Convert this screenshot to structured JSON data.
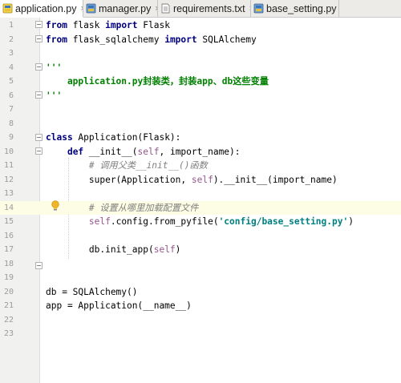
{
  "tabs": [
    {
      "label": "application.py",
      "active": true,
      "icon": "python-file-icon"
    },
    {
      "label": "manager.py",
      "active": false,
      "icon": "python-file-icon"
    },
    {
      "label": "requirements.txt",
      "active": false,
      "icon": "text-file-icon"
    },
    {
      "label": "base_setting.py",
      "active": false,
      "icon": "python-file-icon"
    }
  ],
  "tab_close": "×",
  "colors": {
    "keyword": "#000080",
    "string": "#008080",
    "docstring": "#008000",
    "self": "#94558d",
    "comment": "#808080",
    "highlight_line": "#fdfde5"
  },
  "lines": [
    {
      "n": "1",
      "tokens": [
        {
          "t": "kw",
          "v": "from"
        },
        {
          "t": "p",
          "v": " flask "
        },
        {
          "t": "kw",
          "v": "import"
        },
        {
          "t": "p",
          "v": " Flask"
        }
      ]
    },
    {
      "n": "2",
      "tokens": [
        {
          "t": "kw",
          "v": "from"
        },
        {
          "t": "p",
          "v": " flask_sqlalchemy "
        },
        {
          "t": "kw",
          "v": "import"
        },
        {
          "t": "p",
          "v": " SQLAlchemy"
        }
      ]
    },
    {
      "n": "3",
      "tokens": []
    },
    {
      "n": "4",
      "tokens": [
        {
          "t": "gstr",
          "v": "'''"
        }
      ]
    },
    {
      "n": "5",
      "tokens": [
        {
          "t": "gstr",
          "v": "    application.py封装类，封装app、db这些变量"
        }
      ]
    },
    {
      "n": "6",
      "tokens": [
        {
          "t": "gstr",
          "v": "'''"
        }
      ]
    },
    {
      "n": "7",
      "tokens": []
    },
    {
      "n": "8",
      "tokens": []
    },
    {
      "n": "9",
      "tokens": [
        {
          "t": "kw",
          "v": "class"
        },
        {
          "t": "p",
          "v": " Application(Flask):"
        }
      ]
    },
    {
      "n": "10",
      "tokens": [
        {
          "t": "p",
          "v": "    "
        },
        {
          "t": "kw",
          "v": "def"
        },
        {
          "t": "p",
          "v": " __init__("
        },
        {
          "t": "slf",
          "v": "self"
        },
        {
          "t": "p",
          "v": ", import_name):"
        }
      ]
    },
    {
      "n": "11",
      "tokens": [
        {
          "t": "cmt",
          "v": "        # 调用父类__init__()函数"
        }
      ]
    },
    {
      "n": "12",
      "tokens": [
        {
          "t": "p",
          "v": "        super(Application, "
        },
        {
          "t": "slf",
          "v": "self"
        },
        {
          "t": "p",
          "v": ").__init__(import_name)"
        }
      ]
    },
    {
      "n": "13",
      "tokens": []
    },
    {
      "n": "14",
      "tokens": [
        {
          "t": "cmt",
          "v": "        # 设置从哪里加载配置文件"
        }
      ],
      "highlight": true
    },
    {
      "n": "15",
      "tokens": [
        {
          "t": "p",
          "v": "        "
        },
        {
          "t": "slf",
          "v": "self"
        },
        {
          "t": "p",
          "v": ".config.from_pyfile("
        },
        {
          "t": "str",
          "v": "'config/base_setting.py'"
        },
        {
          "t": "p",
          "v": ")"
        }
      ]
    },
    {
      "n": "16",
      "tokens": []
    },
    {
      "n": "17",
      "tokens": [
        {
          "t": "p",
          "v": "        db.init_app("
        },
        {
          "t": "slf",
          "v": "self"
        },
        {
          "t": "p",
          "v": ")"
        }
      ]
    },
    {
      "n": "18",
      "tokens": []
    },
    {
      "n": "19",
      "tokens": []
    },
    {
      "n": "20",
      "tokens": [
        {
          "t": "p",
          "v": "db = SQLAlchemy()"
        }
      ]
    },
    {
      "n": "21",
      "tokens": [
        {
          "t": "p",
          "v": "app = Application(__name__)"
        }
      ]
    },
    {
      "n": "22",
      "tokens": []
    },
    {
      "n": "23",
      "tokens": []
    }
  ]
}
